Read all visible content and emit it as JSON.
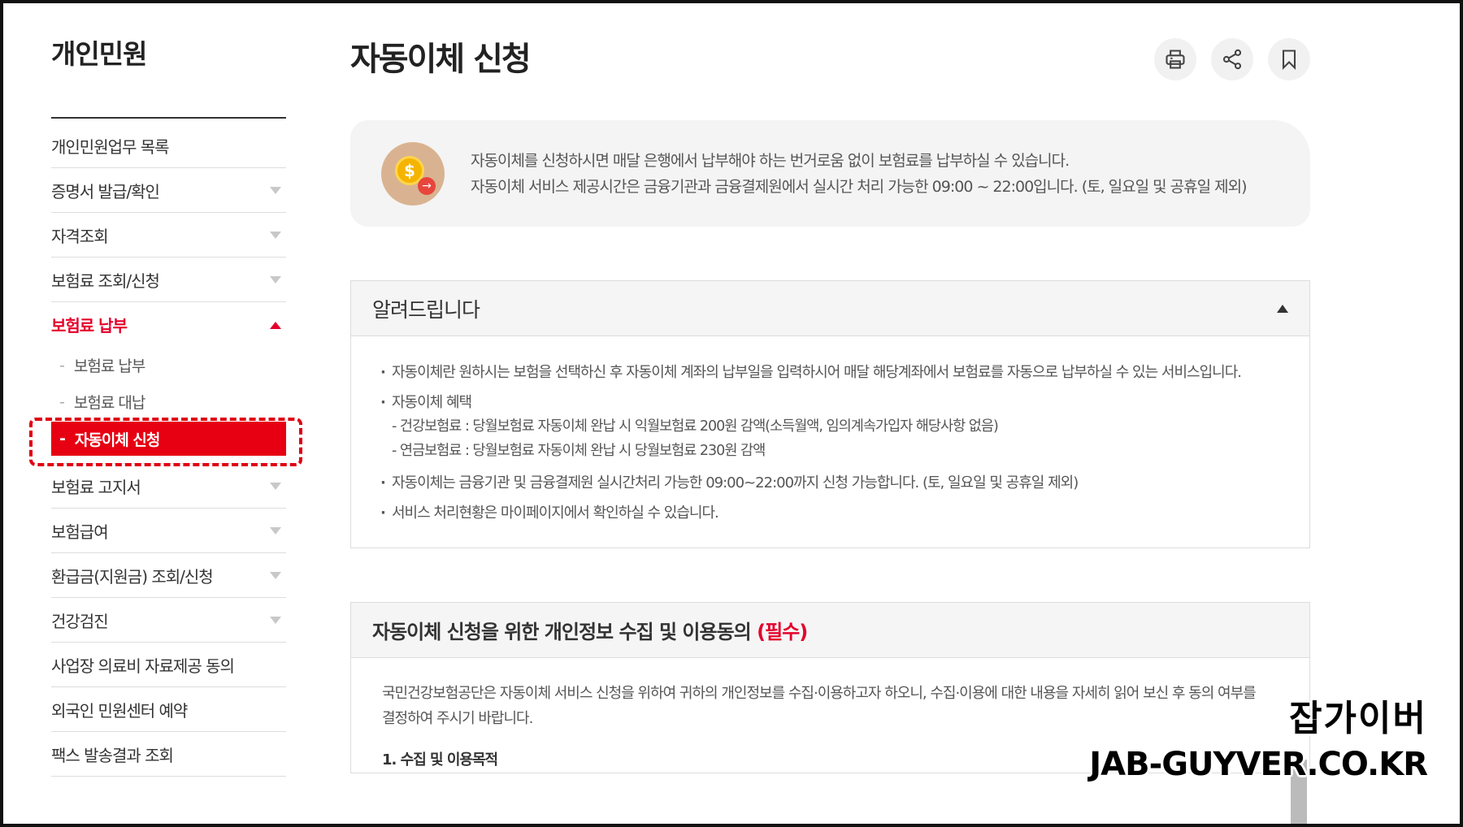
{
  "sidebar": {
    "title": "개인민원",
    "items": [
      {
        "label": "개인민원업무 목록",
        "caret": false
      },
      {
        "label": "증명서 발급/확인",
        "caret": true
      },
      {
        "label": "자격조회",
        "caret": true
      },
      {
        "label": "보험료 조회/신청",
        "caret": true
      },
      {
        "label": "보험료 납부",
        "caret": true,
        "active": true
      }
    ],
    "subitems": [
      {
        "label": "보험료 납부"
      },
      {
        "label": "보험료 대납"
      },
      {
        "label": "자동이체 신청",
        "current": true
      }
    ],
    "items_after": [
      {
        "label": "보험료 고지서",
        "caret": true
      },
      {
        "label": "보험급여",
        "caret": true
      },
      {
        "label": "환급금(지원금) 조회/신청",
        "caret": true
      },
      {
        "label": "건강검진",
        "caret": true
      },
      {
        "label": "사업장 의료비 자료제공 동의",
        "caret": false
      },
      {
        "label": "외국인 민원센터 예약",
        "caret": false
      },
      {
        "label": "팩스 발송결과 조회",
        "caret": false
      }
    ],
    "dash": "-"
  },
  "main": {
    "title": "자동이체 신청",
    "tools": [
      "print-icon",
      "share-icon",
      "bookmark-icon"
    ],
    "info": {
      "icon": "coin-icon",
      "line1": "자동이체를 신청하시면 매달 은행에서 납부해야 하는 번거로움 없이 보험료를 납부하실 수 있습니다.",
      "line2": "자동이체 서비스 제공시간은 금융기관과 금융결제원에서 실시간 처리 가능한 09:00 ~ 22:00입니다. (토, 일요일 및 공휴일 제외)"
    },
    "notice": {
      "title": "알려드립니다",
      "b1": "자동이체란 원하시는 보험을 선택하신 후 자동이체 계좌의 납부일을 입력하시어 매달 해당계좌에서 보험료를 자동으로 납부하실 수 있는 서비스입니다.",
      "b2": "자동이체 혜택",
      "s1": "- 건강보험료 : 당월보험료 자동이체 완납 시 익월보험료 200원 감액(소득월액, 임의계속가입자 해당사항 없음)",
      "s2": "- 연금보험료 : 당월보험료 자동이체 완납 시 당월보험료 230원 감액",
      "b3": "자동이체는 금융기관 및 금융결제원 실시간처리 가능한 09:00~22:00까지 신청 가능합니다. (토, 일요일 및 공휴일 제외)",
      "b4": "서비스 처리현황은 마이페이지에서 확인하실 수 있습니다."
    },
    "consent": {
      "title": "자동이체 신청을 위한 개인정보 수집 및 이용동의",
      "required": "(필수)",
      "body": "국민건강보험공단은 자동이체 서비스 신청을 위하여 귀하의 개인정보를 수집·이용하고자 하오니, 수집·이용에 대한 내용을 자세히 읽어 보신 후 동의 여부를 결정하여 주시기 바랍니다.",
      "section1": "1. 수집 및 이용목적"
    }
  },
  "watermark": {
    "line1": "잡가이버",
    "line2": "JAB-GUYVER.CO.KR"
  },
  "colors": {
    "accent": "#e4002b",
    "highlight": "#e60012"
  }
}
